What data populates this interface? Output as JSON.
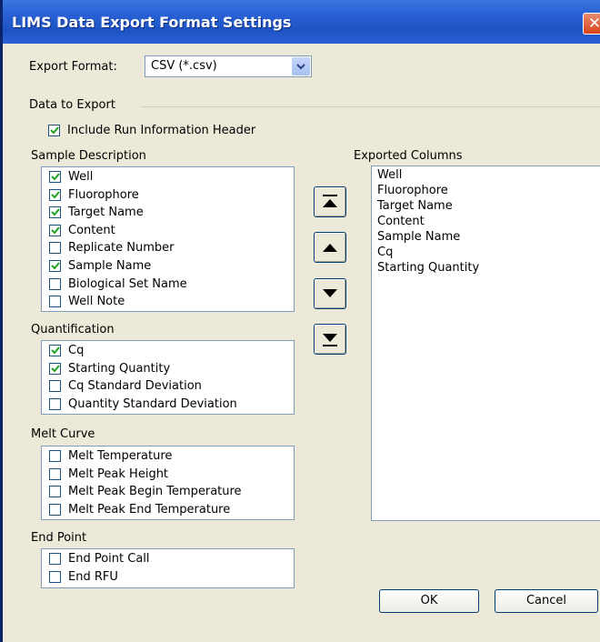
{
  "window": {
    "title": "LIMS Data Export Format Settings",
    "close_glyph": "✕"
  },
  "export_format": {
    "label": "Export Format:",
    "value": "CSV (*.csv)"
  },
  "data_to_export": {
    "label": "Data to Export"
  },
  "include_header": {
    "label": "Include Run Information Header",
    "checked": true
  },
  "sample_description": {
    "label": "Sample Description",
    "items": [
      {
        "label": "Well",
        "checked": true
      },
      {
        "label": "Fluorophore",
        "checked": true
      },
      {
        "label": "Target Name",
        "checked": true
      },
      {
        "label": "Content",
        "checked": true
      },
      {
        "label": "Replicate Number",
        "checked": false
      },
      {
        "label": "Sample Name",
        "checked": true
      },
      {
        "label": "Biological Set Name",
        "checked": false
      },
      {
        "label": "Well Note",
        "checked": false
      }
    ]
  },
  "quantification": {
    "label": "Quantification",
    "items": [
      {
        "label": "Cq",
        "checked": true
      },
      {
        "label": "Starting Quantity",
        "checked": true
      },
      {
        "label": "Cq Standard Deviation",
        "checked": false
      },
      {
        "label": "Quantity Standard Deviation",
        "checked": false
      }
    ]
  },
  "melt_curve": {
    "label": "Melt Curve",
    "items": [
      {
        "label": "Melt Temperature",
        "checked": false
      },
      {
        "label": "Melt Peak Height",
        "checked": false
      },
      {
        "label": "Melt Peak Begin Temperature",
        "checked": false
      },
      {
        "label": "Melt Peak End Temperature",
        "checked": false
      }
    ]
  },
  "end_point": {
    "label": "End Point",
    "items": [
      {
        "label": "End Point Call",
        "checked": false
      },
      {
        "label": "End RFU",
        "checked": false
      }
    ]
  },
  "exported_columns": {
    "label": "Exported Columns",
    "items": [
      "Well",
      "Fluorophore",
      "Target Name",
      "Content",
      "Sample Name",
      "Cq",
      "Starting Quantity"
    ]
  },
  "move_buttons": {
    "icons": [
      "move-to-top-icon",
      "move-up-icon",
      "move-down-icon",
      "move-to-bottom-icon"
    ]
  },
  "buttons": {
    "ok": "OK",
    "cancel": "Cancel"
  },
  "colors": {
    "title_bar": "#2a62d6",
    "dialog_bg": "#ece9d8",
    "close_button": "#d8441c",
    "check_mark": "#21a121"
  }
}
